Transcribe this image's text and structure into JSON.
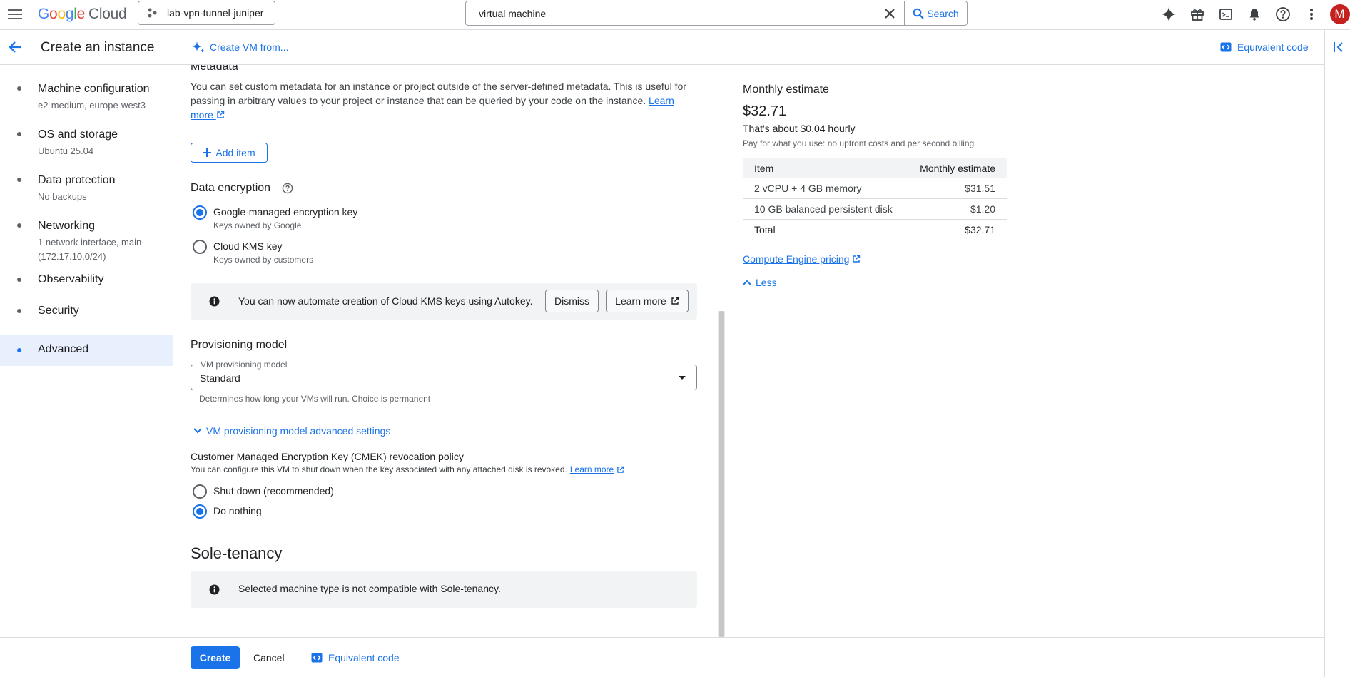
{
  "topbar": {
    "logo_google": "Google",
    "logo_cloud": "Cloud",
    "project_name": "lab-vpn-tunnel-juniper",
    "search_query": "virtual machine",
    "search_button": "Search",
    "avatar_letter": "M"
  },
  "subhead": {
    "title": "Create an instance",
    "create_from": "Create VM from...",
    "equivalent_code": "Equivalent code"
  },
  "sidebar": {
    "items": [
      {
        "label": "Machine configuration",
        "sub": "e2-medium, europe-west3"
      },
      {
        "label": "OS and storage",
        "sub": "Ubuntu 25.04"
      },
      {
        "label": "Data protection",
        "sub": "No backups"
      },
      {
        "label": "Networking",
        "sub": "1 network interface, main",
        "sub2": "(172.17.10.0/24)"
      },
      {
        "label": "Observability"
      },
      {
        "label": "Security"
      },
      {
        "label": "Advanced"
      }
    ]
  },
  "metadata": {
    "heading": "Metadata",
    "desc_line1": "You can set custom metadata for an instance or project outside of the server-defined metadata. This is useful for",
    "desc_line2": "passing in arbitrary values to your project or instance that can be queried by your code on the instance.",
    "learn": "Learn",
    "more": "more",
    "add_item": "Add item"
  },
  "encryption": {
    "heading": "Data encryption",
    "opt1_label": "Google-managed encryption key",
    "opt1_sub": "Keys owned by Google",
    "opt2_label": "Cloud KMS key",
    "opt2_sub": "Keys owned by customers",
    "banner_text": "You can now automate creation of Cloud KMS keys using Autokey.",
    "dismiss": "Dismiss",
    "learn_more": "Learn more"
  },
  "provisioning": {
    "heading": "Provisioning model",
    "select_label": "VM provisioning model",
    "select_value": "Standard",
    "hint": "Determines how long your VMs will run. Choice is permanent",
    "advanced_toggle": "VM provisioning model advanced settings",
    "cmek_heading": "Customer Managed Encryption Key (CMEK) revocation policy",
    "cmek_desc": "You can configure this VM to shut down when the key associated with any attached disk is revoked.",
    "cmek_learn_more": "Learn more",
    "opt_shutdown": "Shut down (recommended)",
    "opt_nothing": "Do nothing"
  },
  "sole_tenancy": {
    "heading": "Sole-tenancy",
    "banner_text": "Selected machine type is not compatible with Sole-tenancy."
  },
  "estimate": {
    "title": "Monthly estimate",
    "total": "$32.71",
    "hourly": "That's about $0.04 hourly",
    "note": "Pay for what you use: no upfront costs and per second billing",
    "col_item": "Item",
    "col_estimate": "Monthly estimate",
    "rows": [
      {
        "item": "2 vCPU + 4 GB memory",
        "cost": "$31.51"
      },
      {
        "item": "10 GB balanced persistent disk",
        "cost": "$1.20"
      },
      {
        "item": "Total",
        "cost": "$32.71"
      }
    ],
    "pricing_link": "Compute Engine pricing",
    "less": "Less"
  },
  "bottombar": {
    "create": "Create",
    "cancel": "Cancel",
    "equivalent_code": "Equivalent code"
  },
  "colors": {
    "accent": "#1a73e8",
    "avatar": "#c5221f"
  }
}
